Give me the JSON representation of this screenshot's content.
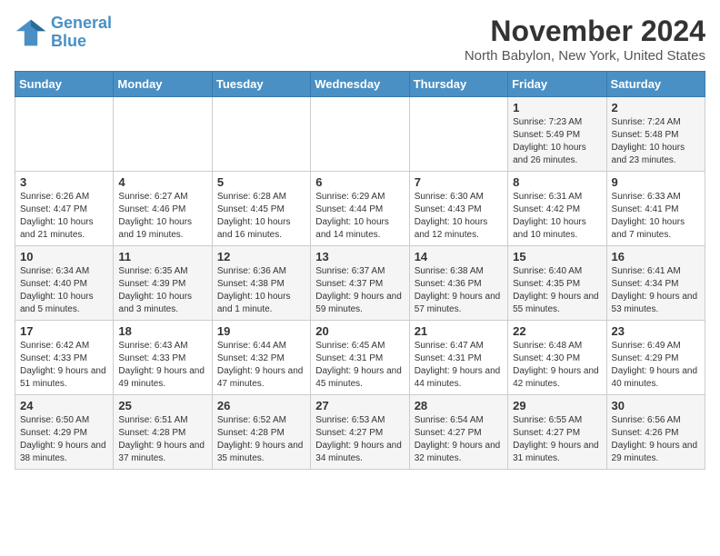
{
  "logo": {
    "line1": "General",
    "line2": "Blue"
  },
  "title": "November 2024",
  "location": "North Babylon, New York, United States",
  "weekdays": [
    "Sunday",
    "Monday",
    "Tuesday",
    "Wednesday",
    "Thursday",
    "Friday",
    "Saturday"
  ],
  "weeks": [
    [
      {
        "day": "",
        "info": ""
      },
      {
        "day": "",
        "info": ""
      },
      {
        "day": "",
        "info": ""
      },
      {
        "day": "",
        "info": ""
      },
      {
        "day": "",
        "info": ""
      },
      {
        "day": "1",
        "info": "Sunrise: 7:23 AM\nSunset: 5:49 PM\nDaylight: 10 hours and 26 minutes."
      },
      {
        "day": "2",
        "info": "Sunrise: 7:24 AM\nSunset: 5:48 PM\nDaylight: 10 hours and 23 minutes."
      }
    ],
    [
      {
        "day": "3",
        "info": "Sunrise: 6:26 AM\nSunset: 4:47 PM\nDaylight: 10 hours and 21 minutes."
      },
      {
        "day": "4",
        "info": "Sunrise: 6:27 AM\nSunset: 4:46 PM\nDaylight: 10 hours and 19 minutes."
      },
      {
        "day": "5",
        "info": "Sunrise: 6:28 AM\nSunset: 4:45 PM\nDaylight: 10 hours and 16 minutes."
      },
      {
        "day": "6",
        "info": "Sunrise: 6:29 AM\nSunset: 4:44 PM\nDaylight: 10 hours and 14 minutes."
      },
      {
        "day": "7",
        "info": "Sunrise: 6:30 AM\nSunset: 4:43 PM\nDaylight: 10 hours and 12 minutes."
      },
      {
        "day": "8",
        "info": "Sunrise: 6:31 AM\nSunset: 4:42 PM\nDaylight: 10 hours and 10 minutes."
      },
      {
        "day": "9",
        "info": "Sunrise: 6:33 AM\nSunset: 4:41 PM\nDaylight: 10 hours and 7 minutes."
      }
    ],
    [
      {
        "day": "10",
        "info": "Sunrise: 6:34 AM\nSunset: 4:40 PM\nDaylight: 10 hours and 5 minutes."
      },
      {
        "day": "11",
        "info": "Sunrise: 6:35 AM\nSunset: 4:39 PM\nDaylight: 10 hours and 3 minutes."
      },
      {
        "day": "12",
        "info": "Sunrise: 6:36 AM\nSunset: 4:38 PM\nDaylight: 10 hours and 1 minute."
      },
      {
        "day": "13",
        "info": "Sunrise: 6:37 AM\nSunset: 4:37 PM\nDaylight: 9 hours and 59 minutes."
      },
      {
        "day": "14",
        "info": "Sunrise: 6:38 AM\nSunset: 4:36 PM\nDaylight: 9 hours and 57 minutes."
      },
      {
        "day": "15",
        "info": "Sunrise: 6:40 AM\nSunset: 4:35 PM\nDaylight: 9 hours and 55 minutes."
      },
      {
        "day": "16",
        "info": "Sunrise: 6:41 AM\nSunset: 4:34 PM\nDaylight: 9 hours and 53 minutes."
      }
    ],
    [
      {
        "day": "17",
        "info": "Sunrise: 6:42 AM\nSunset: 4:33 PM\nDaylight: 9 hours and 51 minutes."
      },
      {
        "day": "18",
        "info": "Sunrise: 6:43 AM\nSunset: 4:33 PM\nDaylight: 9 hours and 49 minutes."
      },
      {
        "day": "19",
        "info": "Sunrise: 6:44 AM\nSunset: 4:32 PM\nDaylight: 9 hours and 47 minutes."
      },
      {
        "day": "20",
        "info": "Sunrise: 6:45 AM\nSunset: 4:31 PM\nDaylight: 9 hours and 45 minutes."
      },
      {
        "day": "21",
        "info": "Sunrise: 6:47 AM\nSunset: 4:31 PM\nDaylight: 9 hours and 44 minutes."
      },
      {
        "day": "22",
        "info": "Sunrise: 6:48 AM\nSunset: 4:30 PM\nDaylight: 9 hours and 42 minutes."
      },
      {
        "day": "23",
        "info": "Sunrise: 6:49 AM\nSunset: 4:29 PM\nDaylight: 9 hours and 40 minutes."
      }
    ],
    [
      {
        "day": "24",
        "info": "Sunrise: 6:50 AM\nSunset: 4:29 PM\nDaylight: 9 hours and 38 minutes."
      },
      {
        "day": "25",
        "info": "Sunrise: 6:51 AM\nSunset: 4:28 PM\nDaylight: 9 hours and 37 minutes."
      },
      {
        "day": "26",
        "info": "Sunrise: 6:52 AM\nSunset: 4:28 PM\nDaylight: 9 hours and 35 minutes."
      },
      {
        "day": "27",
        "info": "Sunrise: 6:53 AM\nSunset: 4:27 PM\nDaylight: 9 hours and 34 minutes."
      },
      {
        "day": "28",
        "info": "Sunrise: 6:54 AM\nSunset: 4:27 PM\nDaylight: 9 hours and 32 minutes."
      },
      {
        "day": "29",
        "info": "Sunrise: 6:55 AM\nSunset: 4:27 PM\nDaylight: 9 hours and 31 minutes."
      },
      {
        "day": "30",
        "info": "Sunrise: 6:56 AM\nSunset: 4:26 PM\nDaylight: 9 hours and 29 minutes."
      }
    ]
  ]
}
